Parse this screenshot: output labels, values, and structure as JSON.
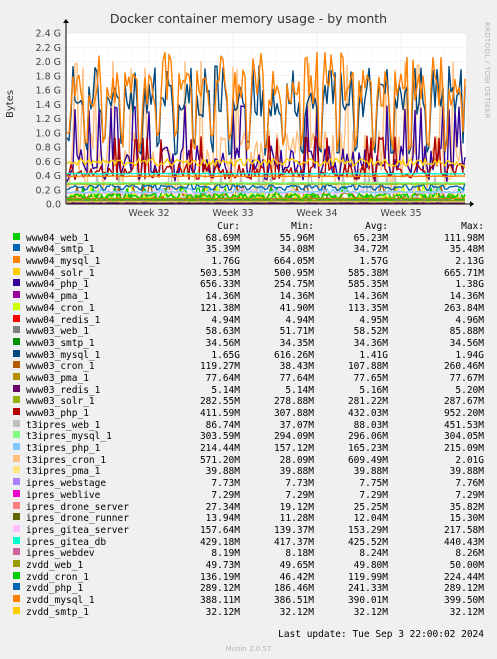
{
  "chart_data": {
    "type": "line",
    "title": "Docker container memory usage - by month",
    "ylabel": "Bytes",
    "side_label": "RRDTOOL / TOBI OETIKER",
    "ylim": [
      0,
      2400000000
    ],
    "y_ticks": [
      {
        "value": 0,
        "label": "0.0"
      },
      {
        "value": 200000000,
        "label": "0.2 G"
      },
      {
        "value": 400000000,
        "label": "0.4 G"
      },
      {
        "value": 600000000,
        "label": "0.6 G"
      },
      {
        "value": 800000000,
        "label": "0.8 G"
      },
      {
        "value": 1000000000,
        "label": "1.0 G"
      },
      {
        "value": 1200000000,
        "label": "1.2 G"
      },
      {
        "value": 1400000000,
        "label": "1.4 G"
      },
      {
        "value": 1600000000,
        "label": "1.6 G"
      },
      {
        "value": 1800000000,
        "label": "1.8 G"
      },
      {
        "value": 2000000000,
        "label": "2.0 G"
      },
      {
        "value": 2200000000,
        "label": "2.2 G"
      },
      {
        "value": 2400000000,
        "label": "2.4 G"
      }
    ],
    "x_ticks": [
      "Week 32",
      "Week 33",
      "Week 34",
      "Week 35"
    ],
    "grid": true,
    "legend_columns": [
      "Cur:",
      "Min:",
      "Avg:",
      "Max:"
    ],
    "series": [
      {
        "name": "www04_web_1",
        "color": "#00cc00",
        "cur": "68.69M",
        "min": "55.96M",
        "avg": "65.23M",
        "max": "111.98M"
      },
      {
        "name": "www04_smtp_1",
        "color": "#0066b3",
        "cur": "35.39M",
        "min": "34.08M",
        "avg": "34.72M",
        "max": "35.48M"
      },
      {
        "name": "www04_mysql_1",
        "color": "#ff8000",
        "cur": "1.76G",
        "min": "664.05M",
        "avg": "1.57G",
        "max": "2.13G"
      },
      {
        "name": "www04_solr_1",
        "color": "#ffcc00",
        "cur": "503.53M",
        "min": "500.95M",
        "avg": "585.38M",
        "max": "665.71M"
      },
      {
        "name": "www04_php_1",
        "color": "#330099",
        "cur": "656.33M",
        "min": "254.75M",
        "avg": "585.35M",
        "max": "1.38G"
      },
      {
        "name": "www04_pma_1",
        "color": "#990099",
        "cur": "14.36M",
        "min": "14.36M",
        "avg": "14.36M",
        "max": "14.36M"
      },
      {
        "name": "www04_cron_1",
        "color": "#ccff00",
        "cur": "121.38M",
        "min": "41.90M",
        "avg": "113.35M",
        "max": "263.84M"
      },
      {
        "name": "www04_redis_1",
        "color": "#ff0000",
        "cur": "4.94M",
        "min": "4.94M",
        "avg": "4.95M",
        "max": "4.96M"
      },
      {
        "name": "www03_web_1",
        "color": "#808080",
        "cur": "58.63M",
        "min": "51.71M",
        "avg": "58.52M",
        "max": "85.88M"
      },
      {
        "name": "www03_smtp_1",
        "color": "#008f00",
        "cur": "34.56M",
        "min": "34.35M",
        "avg": "34.36M",
        "max": "34.56M"
      },
      {
        "name": "www03_mysql_1",
        "color": "#00487d",
        "cur": "1.65G",
        "min": "616.26M",
        "avg": "1.41G",
        "max": "1.94G"
      },
      {
        "name": "www03_cron_1",
        "color": "#b35a00",
        "cur": "119.27M",
        "min": "38.43M",
        "avg": "107.88M",
        "max": "260.46M"
      },
      {
        "name": "www03_pma_1",
        "color": "#b38f00",
        "cur": "77.64M",
        "min": "77.64M",
        "avg": "77.65M",
        "max": "77.67M"
      },
      {
        "name": "www03_redis_1",
        "color": "#6b006b",
        "cur": "5.14M",
        "min": "5.14M",
        "avg": "5.16M",
        "max": "5.20M"
      },
      {
        "name": "www03_solr_1",
        "color": "#8fb300",
        "cur": "282.55M",
        "min": "278.88M",
        "avg": "281.22M",
        "max": "287.67M"
      },
      {
        "name": "www03_php_1",
        "color": "#b30000",
        "cur": "411.59M",
        "min": "307.88M",
        "avg": "432.03M",
        "max": "952.20M"
      },
      {
        "name": "t3ipres_web_1",
        "color": "#bebebe",
        "cur": "86.74M",
        "min": "37.07M",
        "avg": "88.03M",
        "max": "451.53M"
      },
      {
        "name": "t3ipres_mysql_1",
        "color": "#80ff80",
        "cur": "303.59M",
        "min": "294.09M",
        "avg": "296.06M",
        "max": "304.05M"
      },
      {
        "name": "t3ipres_php_1",
        "color": "#80c9ff",
        "cur": "214.44M",
        "min": "157.12M",
        "avg": "165.23M",
        "max": "215.09M"
      },
      {
        "name": "t3ipres_cron_1",
        "color": "#ffc080",
        "cur": "571.20M",
        "min": "28.09M",
        "avg": "609.49M",
        "max": "2.01G"
      },
      {
        "name": "t3ipres_pma_1",
        "color": "#ffe680",
        "cur": "39.88M",
        "min": "39.88M",
        "avg": "39.88M",
        "max": "39.88M"
      },
      {
        "name": "ipres_webstage",
        "color": "#aa80ff",
        "cur": "7.73M",
        "min": "7.73M",
        "avg": "7.75M",
        "max": "7.76M"
      },
      {
        "name": "ipres_weblive",
        "color": "#ee00cc",
        "cur": "7.29M",
        "min": "7.29M",
        "avg": "7.29M",
        "max": "7.29M"
      },
      {
        "name": "ipres_drone_server",
        "color": "#ff8080",
        "cur": "27.34M",
        "min": "19.12M",
        "avg": "25.25M",
        "max": "35.82M"
      },
      {
        "name": "ipres_drone_runner",
        "color": "#666600",
        "cur": "13.94M",
        "min": "11.28M",
        "avg": "12.04M",
        "max": "15.30M"
      },
      {
        "name": "ipres_gitea_server",
        "color": "#ffbfff",
        "cur": "157.64M",
        "min": "139.37M",
        "avg": "153.29M",
        "max": "217.58M"
      },
      {
        "name": "ipres_gitea_db",
        "color": "#00ffcc",
        "cur": "429.18M",
        "min": "417.37M",
        "avg": "425.52M",
        "max": "440.43M"
      },
      {
        "name": "ipres_webdev",
        "color": "#cc6699",
        "cur": "8.19M",
        "min": "8.18M",
        "avg": "8.24M",
        "max": "8.26M"
      },
      {
        "name": "zvdd_web_1",
        "color": "#999900",
        "cur": "49.73M",
        "min": "49.65M",
        "avg": "49.80M",
        "max": "50.00M"
      },
      {
        "name": "zvdd_cron_1",
        "color": "#00cc00",
        "cur": "136.19M",
        "min": "46.42M",
        "avg": "119.99M",
        "max": "224.44M"
      },
      {
        "name": "zvdd_php_1",
        "color": "#0066b3",
        "cur": "289.12M",
        "min": "186.46M",
        "avg": "241.33M",
        "max": "289.12M"
      },
      {
        "name": "zvdd_mysql_1",
        "color": "#ff8000",
        "cur": "388.11M",
        "min": "386.51M",
        "avg": "390.01M",
        "max": "399.50M"
      },
      {
        "name": "zvdd_smtp_1",
        "color": "#ffcc00",
        "cur": "32.12M",
        "min": "32.12M",
        "avg": "32.12M",
        "max": "32.12M"
      }
    ]
  },
  "footer": {
    "last_update": "Last update: Tue Sep  3 22:00:02 2024",
    "munin_version": "Munin 2.0.57"
  }
}
